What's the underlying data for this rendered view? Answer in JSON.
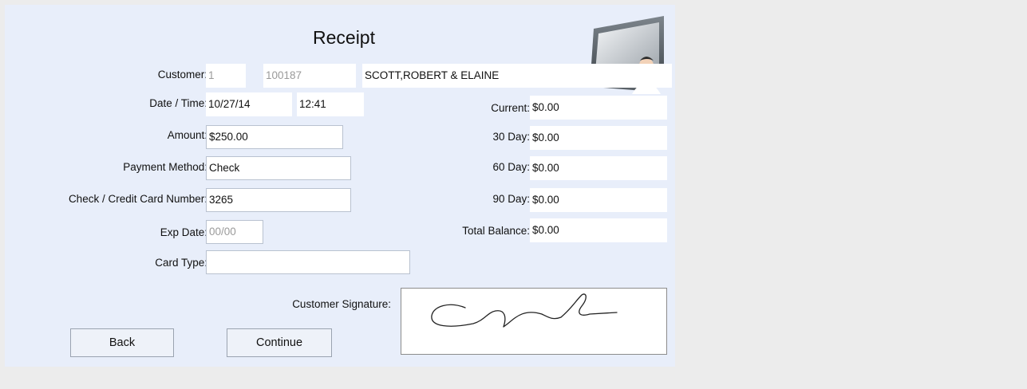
{
  "header": {
    "title": "Receipt"
  },
  "customer": {
    "label": "Customer:",
    "num": "1",
    "account": "100187",
    "name": "SCOTT,ROBERT & ELAINE"
  },
  "datetime": {
    "label": "Date / Time:",
    "date": "10/27/14",
    "time": "12:41"
  },
  "amount": {
    "label": "Amount:",
    "value": "$250.00"
  },
  "payment_method": {
    "label": "Payment Method:",
    "value": "Check"
  },
  "card_number": {
    "label": "Check / Credit Card Number:",
    "value": "3265"
  },
  "exp_date": {
    "label": "Exp Date:",
    "placeholder": "00/00"
  },
  "card_type": {
    "label": "Card Type:",
    "value": ""
  },
  "balances": {
    "current": {
      "label": "Current:",
      "value": "$0.00"
    },
    "d30": {
      "label": "30 Day:",
      "value": "$0.00"
    },
    "d60": {
      "label": "60 Day:",
      "value": "$0.00"
    },
    "d90": {
      "label": "90 Day:",
      "value": "$0.00"
    },
    "total": {
      "label": "Total Balance:",
      "value": "$0.00"
    }
  },
  "signature": {
    "label": "Customer Signature:"
  },
  "buttons": {
    "back": "Back",
    "continue": "Continue"
  },
  "icons": {
    "monitor": "computer-monitor-user-icon"
  }
}
